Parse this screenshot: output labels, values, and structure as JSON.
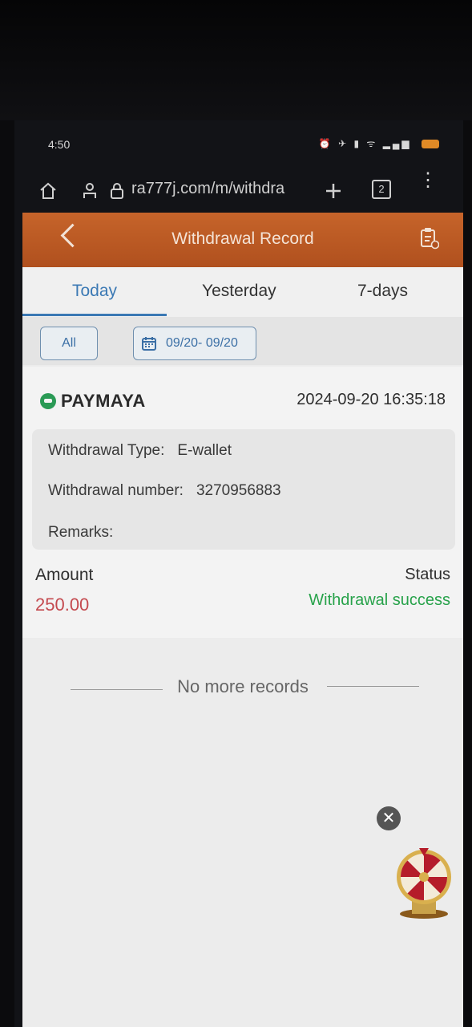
{
  "status_bar": {
    "time": "4:50",
    "icons": "⏰ ✈ ▮ ᯤ ▂▄▆"
  },
  "browser": {
    "url": "ra777j.com/m/withdra",
    "tab_count": "2"
  },
  "header": {
    "title": "Withdrawal Record"
  },
  "tabs": [
    {
      "label": "Today",
      "active": true
    },
    {
      "label": "Yesterday",
      "active": false
    },
    {
      "label": "7-days",
      "active": false
    }
  ],
  "filters": {
    "all_label": "All",
    "date_range": "09/20- 09/20"
  },
  "record": {
    "brand": "PAYMAYA",
    "datetime": "2024-09-20 16:35:18",
    "withdrawal_type_label": "Withdrawal Type:",
    "withdrawal_type_value": "E-wallet",
    "withdrawal_number_label": "Withdrawal number:",
    "withdrawal_number_value": "3270956883",
    "remarks_label": "Remarks:",
    "remarks_value": "",
    "amount_label": "Amount",
    "amount_value": "250.00",
    "status_label": "Status",
    "status_value": "Withdrawal success"
  },
  "footer": {
    "no_more": "No more records"
  },
  "colors": {
    "header": "#b8561f",
    "accent": "#3b79b4",
    "amount": "#c44a4f",
    "success": "#27a24a"
  }
}
